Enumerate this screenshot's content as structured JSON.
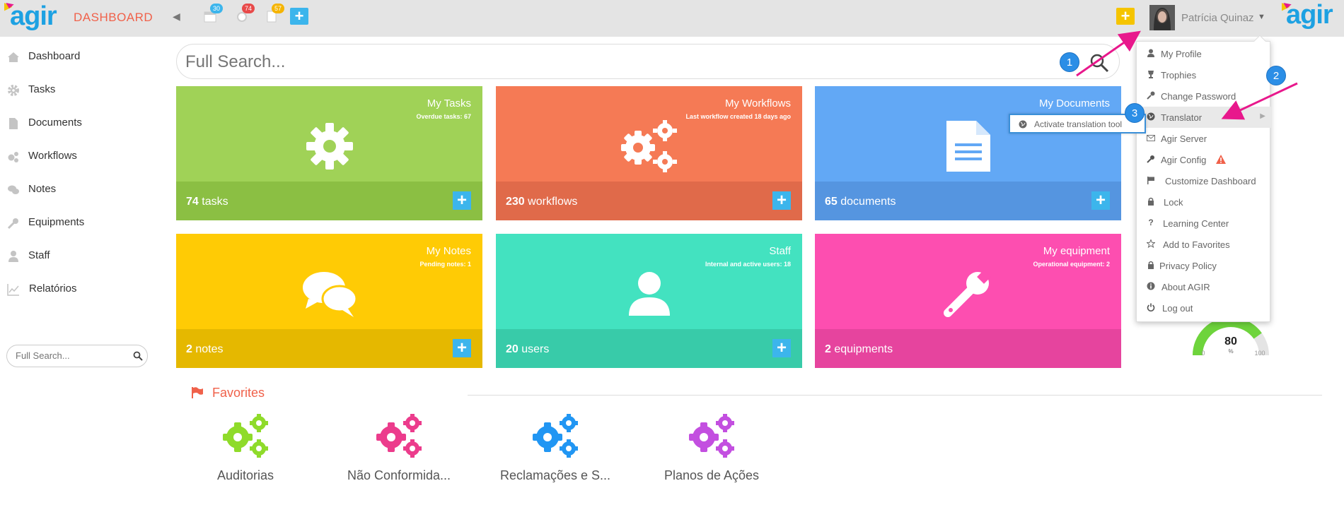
{
  "header": {
    "brand": "agir",
    "title": "DASHBOARD",
    "badges": {
      "tasks": "30",
      "workflows": "74",
      "documents": "57"
    },
    "user_name": "Patrícia Quinaz"
  },
  "sidebar": {
    "items": [
      {
        "label": "Dashboard",
        "icon": "home-icon"
      },
      {
        "label": "Tasks",
        "icon": "gear-icon"
      },
      {
        "label": "Documents",
        "icon": "document-icon"
      },
      {
        "label": "Workflows",
        "icon": "gears-icon"
      },
      {
        "label": "Notes",
        "icon": "comments-icon"
      },
      {
        "label": "Equipments",
        "icon": "wrench-icon"
      },
      {
        "label": "Staff",
        "icon": "user-icon"
      },
      {
        "label": "Relatórios",
        "icon": "chart-icon"
      }
    ],
    "search_placeholder": "Full Search..."
  },
  "search": {
    "placeholder": "Full Search..."
  },
  "tiles": [
    {
      "title": "My Tasks",
      "subtitle": "Overdue tasks: 67",
      "count": "74",
      "unit": "tasks",
      "color": "#a0d257",
      "footer_color": "#8bbf43"
    },
    {
      "title": "My Workflows",
      "subtitle": "Last workflow created 18 days ago",
      "count": "230",
      "unit": "workflows",
      "color": "#f57a55",
      "footer_color": "#e06a4a"
    },
    {
      "title": "My Documents",
      "subtitle": "",
      "count": "65",
      "unit": "documents",
      "color": "#62a8f5",
      "footer_color": "#5595e0"
    },
    {
      "title": "My Notes",
      "subtitle": "Pending notes: 1",
      "count": "2",
      "unit": "notes",
      "color": "#ffcb05",
      "footer_color": "#e5b800"
    },
    {
      "title": "Staff",
      "subtitle": "Internal and active users: 18",
      "count": "20",
      "unit": "users",
      "color": "#43e2c0",
      "footer_color": "#38cba9"
    },
    {
      "title": "My equipment",
      "subtitle": "Operational equipment: 2",
      "count": "2",
      "unit": "equipments",
      "color": "#fd4eb0",
      "footer_color": "#e6449e"
    }
  ],
  "favorites": {
    "heading": "Favorites",
    "items": [
      {
        "label": "Auditorias",
        "color": "#8fdb2a"
      },
      {
        "label": "Não Conformida...",
        "color": "#ec3c8c"
      },
      {
        "label": "Reclamações e S...",
        "color": "#2196f3"
      },
      {
        "label": "Planos de Ações",
        "color": "#c34fe0"
      }
    ]
  },
  "gauge": {
    "value": "80",
    "unit": "%",
    "min": "0",
    "max": "100",
    "fraction": 0.8
  },
  "user_menu": {
    "items": [
      {
        "label": "My Profile",
        "icon": "user-icon"
      },
      {
        "label": "Trophies",
        "icon": "trophy-icon"
      },
      {
        "label": "Change Password",
        "icon": "key-icon"
      },
      {
        "label": "Translator",
        "icon": "globe-icon"
      },
      {
        "label": "Agir Server",
        "icon": "envelope-icon"
      },
      {
        "label": "Agir Config",
        "icon": "wrench-icon"
      },
      {
        "label": "Customize Dashboard",
        "icon": "flag-icon"
      },
      {
        "label": "Lock",
        "icon": "lock-icon"
      },
      {
        "label": "Learning Center",
        "icon": "question-icon"
      },
      {
        "label": "Add to Favorites",
        "icon": "star-icon"
      },
      {
        "label": "Privacy Policy",
        "icon": "lock-icon"
      },
      {
        "label": "About AGIR",
        "icon": "info-icon"
      },
      {
        "label": "Log out",
        "icon": "power-icon"
      }
    ],
    "submenu_item": "Activate translation tool"
  },
  "callouts": [
    "1",
    "2",
    "3"
  ],
  "colors": {
    "accent": "#f0614a",
    "brand": "#1da1e2",
    "callout": "#2b8ee6",
    "arrow": "#e8188c"
  }
}
